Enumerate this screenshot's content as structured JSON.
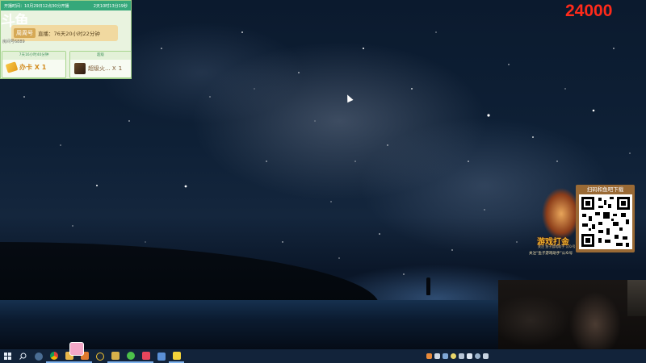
{
  "overlay": {
    "header_left": "开播时间：10月29日12点30分开播",
    "header_right": "2天10时13分19秒",
    "logo_text": "斗鱼",
    "streamer_name": "周周号",
    "streamer_text": "直播：76天20小时22分钟",
    "room_id": "房间号6889",
    "card_box": {
      "title": "7天16小时40分钟",
      "label": "办卡 X 1"
    },
    "gift_box": {
      "title": "超级",
      "label": "超级火... X",
      "count": "1"
    }
  },
  "counter": "24000",
  "promo": {
    "qr_caption": "扫码和鱼吧下载",
    "brand": "游戏打金",
    "sub": "关注 鱼子游戏助手 公众号",
    "footer": "关注“鱼子游戏助手”公众号"
  },
  "taskbar": {
    "start_icon": "windows-logo",
    "search_icon": "search",
    "apps": [
      "steam",
      "chrome",
      "file-explorer",
      "media-player",
      "qq-music",
      "game-client",
      "wechat",
      "qq",
      "network",
      "notes"
    ]
  },
  "colors": {
    "counter": "#ff2a1a",
    "widget_header": "#35a87a",
    "taskbar": "#12233a"
  }
}
